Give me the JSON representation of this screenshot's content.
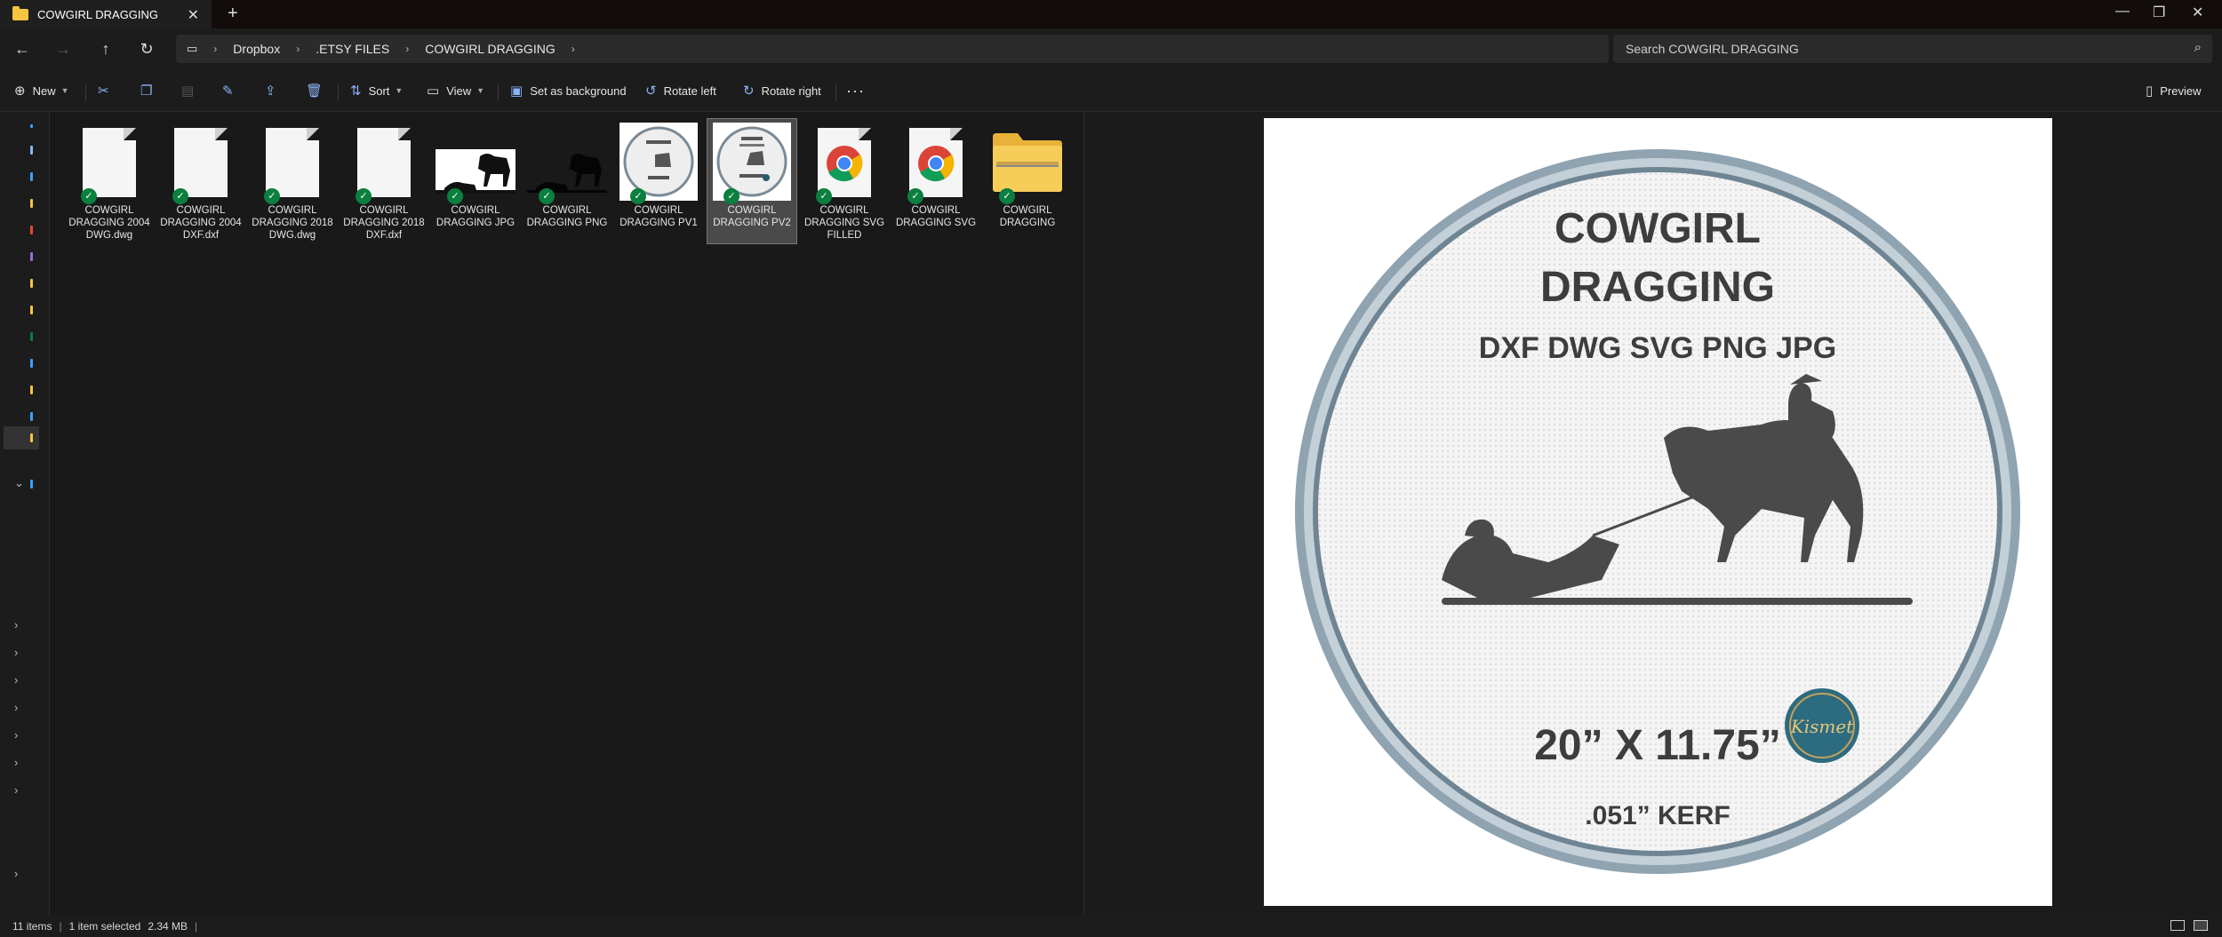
{
  "window": {
    "tab_title": "COWGIRL DRAGGING",
    "tab_close": "✕",
    "new_tab": "+",
    "minimize": "—",
    "maximize": "❐",
    "close": "✕"
  },
  "address": {
    "breadcrumbs": [
      "Dropbox",
      ".ETSY FILES",
      "COWGIRL DRAGGING"
    ],
    "search_placeholder": "Search COWGIRL DRAGGING"
  },
  "toolbar": {
    "new_label": "New",
    "sort_label": "Sort",
    "view_label": "View",
    "set_background_label": "Set as background",
    "rotate_left_label": "Rotate left",
    "rotate_right_label": "Rotate right",
    "more_label": "···",
    "preview_label": "Preview"
  },
  "files": [
    {
      "name_line1": "COWGIRL",
      "name_line2": "DRAGGING 2004",
      "name_line3": "DWG.dwg",
      "icon": "document-icon"
    },
    {
      "name_line1": "COWGIRL",
      "name_line2": "DRAGGING 2004",
      "name_line3": "DXF.dxf",
      "icon": "document-icon"
    },
    {
      "name_line1": "COWGIRL",
      "name_line2": "DRAGGING 2018",
      "name_line3": "DWG.dwg",
      "icon": "document-icon"
    },
    {
      "name_line1": "COWGIRL",
      "name_line2": "DRAGGING 2018",
      "name_line3": "DXF.dxf",
      "icon": "document-icon"
    },
    {
      "name_line1": "COWGIRL",
      "name_line2": "DRAGGING JPG",
      "name_line3": "",
      "icon": "image-thumbnail"
    },
    {
      "name_line1": "COWGIRL",
      "name_line2": "DRAGGING PNG",
      "name_line3": "",
      "icon": "image-thumbnail"
    },
    {
      "name_line1": "COWGIRL",
      "name_line2": "DRAGGING PV1",
      "name_line3": "",
      "icon": "image-thumbnail"
    },
    {
      "name_line1": "COWGIRL",
      "name_line2": "DRAGGING PV2",
      "name_line3": "",
      "icon": "image-thumbnail"
    },
    {
      "name_line1": "COWGIRL",
      "name_line2": "DRAGGING SVG",
      "name_line3": "FILLED",
      "icon": "chrome-icon"
    },
    {
      "name_line1": "COWGIRL",
      "name_line2": "DRAGGING SVG",
      "name_line3": "",
      "icon": "chrome-icon"
    },
    {
      "name_line1": "COWGIRL",
      "name_line2": "DRAGGING",
      "name_line3": "",
      "icon": "zip-folder-icon"
    }
  ],
  "preview_image": {
    "title_line1": "COWGIRL",
    "title_line2": "DRAGGING",
    "formats": "DXF DWG SVG PNG JPG",
    "size": "20” X 11.75”",
    "kerf": ".051” KERF",
    "logo_text": "Kismet"
  },
  "status": {
    "items": "11 items",
    "selected": "1 item selected",
    "size": "2.34 MB"
  },
  "colors": {
    "accent": "#8ab4f8",
    "sync_check": "#0a7f3f",
    "folder": "#f5c443"
  }
}
